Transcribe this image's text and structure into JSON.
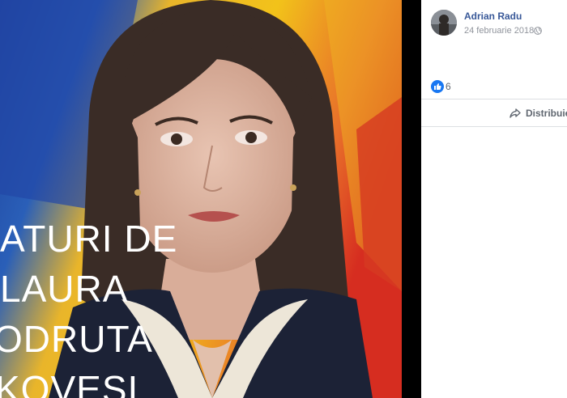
{
  "post": {
    "author": "Adrian Radu",
    "date": "24 februarie 2018",
    "privacy_icon": "globe-icon",
    "reaction_icon": "like-icon",
    "reaction_count": "6",
    "share_label": "Distribuie",
    "share_icon": "share-icon"
  },
  "photo": {
    "overlay_lines": [
      "ATURI DE",
      "LAURA",
      "ODRUTA",
      "KOVESI"
    ]
  },
  "colors": {
    "author_link": "#385898",
    "meta_text": "#90949c",
    "like_blue": "#1877f2",
    "divider": "#dddfe2",
    "flag_blue": "#1d3e99",
    "flag_yellow": "#f2c21a",
    "flag_red": "#d62d20"
  }
}
